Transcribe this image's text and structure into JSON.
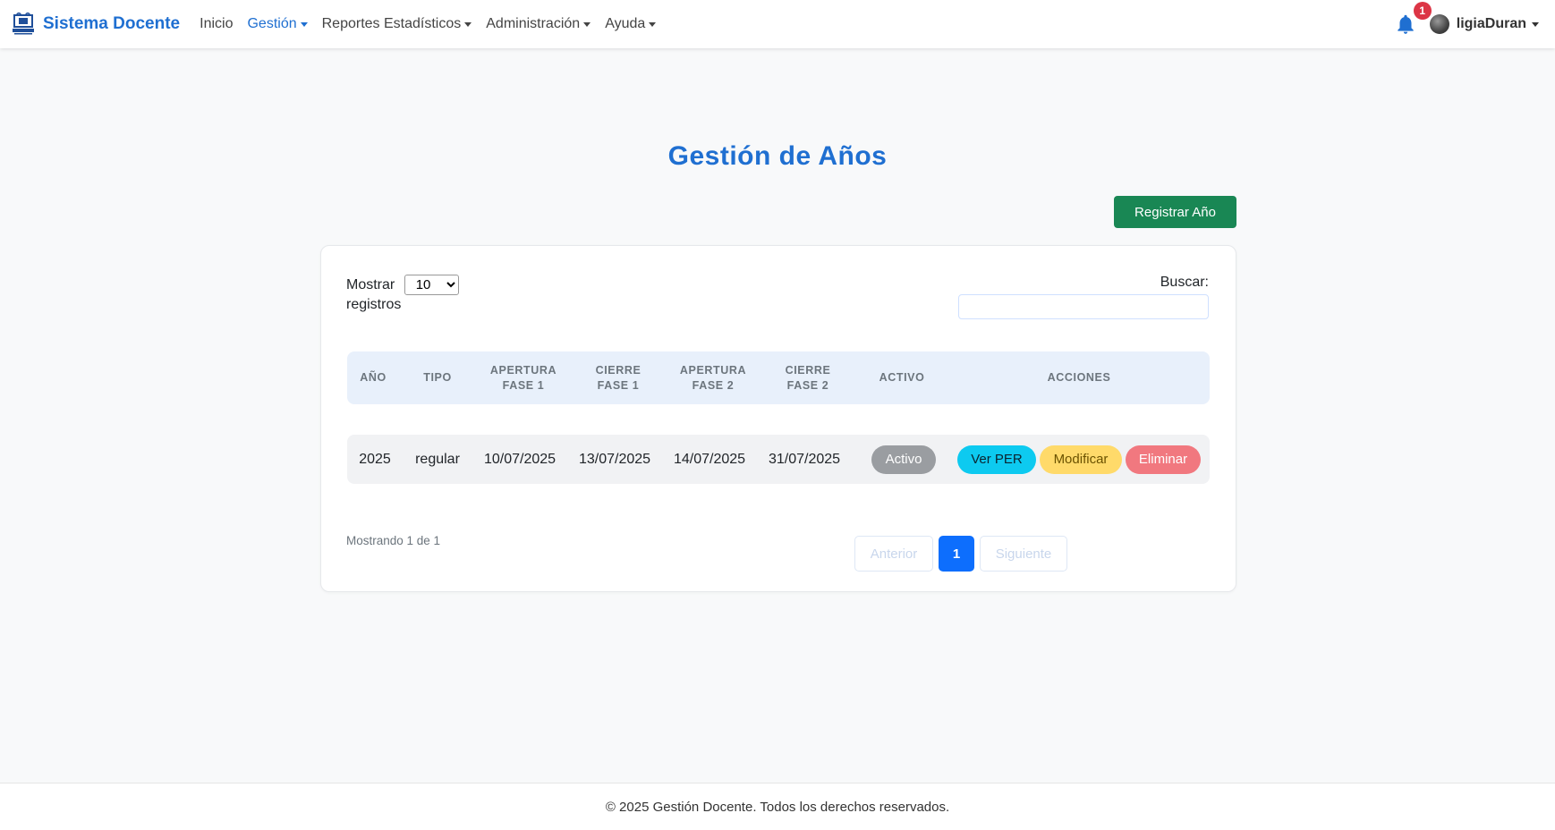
{
  "navbar": {
    "brand": "Sistema Docente",
    "logo_icon": "university-logo-icon",
    "items": [
      {
        "label": "Inicio",
        "active": false,
        "dropdown": false
      },
      {
        "label": "Gestión",
        "active": true,
        "dropdown": true
      },
      {
        "label": "Reportes Estadísticos",
        "active": false,
        "dropdown": true
      },
      {
        "label": "Administración",
        "active": false,
        "dropdown": true
      },
      {
        "label": "Ayuda",
        "active": false,
        "dropdown": true
      }
    ],
    "notifications": {
      "icon": "bell-icon",
      "count": "1"
    },
    "user": {
      "name": "ligiaDuran",
      "avatar_icon": "avatar-icon"
    }
  },
  "page": {
    "title": "Gestión de Años",
    "register_button": "Registrar Año"
  },
  "table_controls": {
    "show_label": "Mostrar",
    "show_value": "10",
    "show_options": [
      "10"
    ],
    "records_label": "registros",
    "search_label": "Buscar:",
    "search_value": ""
  },
  "table": {
    "columns": [
      [
        "AÑO"
      ],
      [
        "TIPO"
      ],
      [
        "APERTURA",
        "FASE 1"
      ],
      [
        "CIERRE",
        "FASE 1"
      ],
      [
        "APERTURA",
        "FASE 2"
      ],
      [
        "CIERRE",
        "FASE 2"
      ],
      [
        "ACTIVO"
      ],
      [
        "ACCIONES"
      ]
    ],
    "rows": [
      {
        "anio": "2025",
        "tipo": "regular",
        "apertura_fase1": "10/07/2025",
        "cierre_fase1": "13/07/2025",
        "apertura_fase2": "14/07/2025",
        "cierre_fase2": "31/07/2025",
        "activo": "Activo",
        "actions": {
          "ver": "Ver PER",
          "modificar": "Modificar",
          "eliminar": "Eliminar"
        }
      }
    ]
  },
  "pagination": {
    "info": "Mostrando 1 de 1",
    "previous": "Anterior",
    "current_page": "1",
    "next": "Siguiente"
  },
  "footer": {
    "text": "© 2025 Gestión Docente. Todos los derechos reservados."
  },
  "colors": {
    "brand": "#1f6fd1",
    "success": "#198754",
    "info": "#0dcaf0",
    "warning": "#ffda6a",
    "danger": "#f1787f",
    "primary": "#0d6efd"
  }
}
